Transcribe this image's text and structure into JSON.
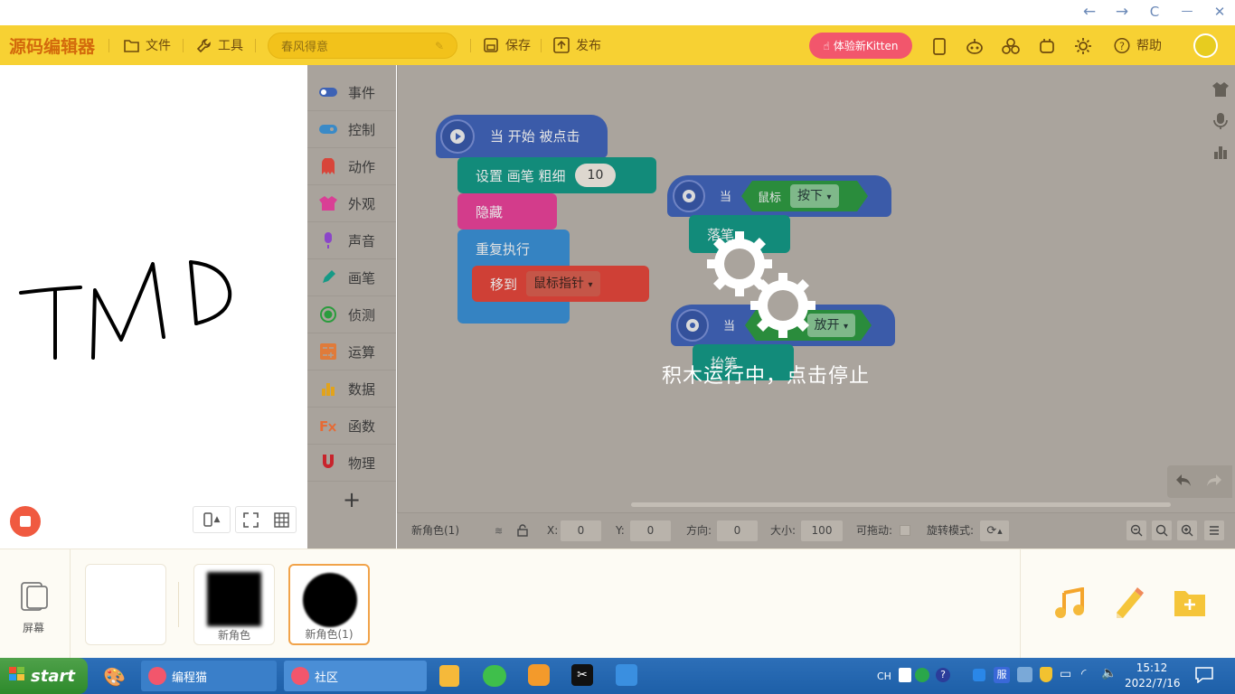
{
  "window": {
    "nav_back": "←",
    "nav_forward": "→",
    "refresh": "C",
    "minimize": "—",
    "close": "✕"
  },
  "menubar": {
    "logo": "源码编辑器",
    "file": "文件",
    "tools": "工具",
    "project_title": "春风得意",
    "save": "保存",
    "publish": "发布",
    "try_kitten": "体验新Kitten",
    "help": "帮助"
  },
  "stage": {
    "drawing_text": "TMD"
  },
  "categories": [
    {
      "label": "事件",
      "color": "#3d62b5"
    },
    {
      "label": "控制",
      "color": "#3a8ac7"
    },
    {
      "label": "动作",
      "color": "#d8453a"
    },
    {
      "label": "外观",
      "color": "#d93f95"
    },
    {
      "label": "声音",
      "color": "#8b45c9"
    },
    {
      "label": "画笔",
      "color": "#159a86"
    },
    {
      "label": "侦测",
      "color": "#2a9c3d"
    },
    {
      "label": "运算",
      "color": "#e07b3a"
    },
    {
      "label": "数据",
      "color": "#e2a31b"
    },
    {
      "label": "函数",
      "color": "#e66b35"
    },
    {
      "label": "物理",
      "color": "#c8242c"
    }
  ],
  "add_category": "+",
  "blocks": {
    "start_hat": "当 开始 被点击",
    "set_pen_width": "设置 画笔 粗细",
    "pen_width_value": "10",
    "hide": "隐藏",
    "repeat_forever": "重复执行",
    "move_to": "移到",
    "move_to_target": "鼠标指针",
    "when1_prefix": "当",
    "mouse_label": "鼠标",
    "mouse_down": "按下",
    "pen_down": "落笔",
    "when2_prefix": "当",
    "mouse_release": "放开",
    "pen_up": "抬笔"
  },
  "overlay": {
    "running_text": "积木运行中，点击停止"
  },
  "properties": {
    "sprite_name": "新角色(1)",
    "x_label": "X:",
    "x_value": "0",
    "y_label": "Y:",
    "y_value": "0",
    "direction_label": "方向:",
    "direction_value": "0",
    "size_label": "大小:",
    "size_value": "100",
    "draggable_label": "可拖动:",
    "rotation_label": "旋转模式:"
  },
  "spritebar": {
    "screen_label": "屏幕",
    "sprites": [
      "新角色",
      "新角色(1)"
    ]
  },
  "taskbar": {
    "start": "start",
    "tasks": [
      "编程猫",
      "社区"
    ],
    "ime": "CH",
    "tray_service": "服",
    "time": "15:12",
    "date": "2022/7/16"
  },
  "colors": {
    "menubar": "#f7d133",
    "accent_red": "#f2566c",
    "events_blue": "#3d62b5",
    "pen_teal": "#159a86",
    "looks_pink": "#d93f95",
    "control_blue": "#3a8ac7",
    "motion_red": "#d8453a",
    "sensing_green": "#2a9c3d"
  }
}
